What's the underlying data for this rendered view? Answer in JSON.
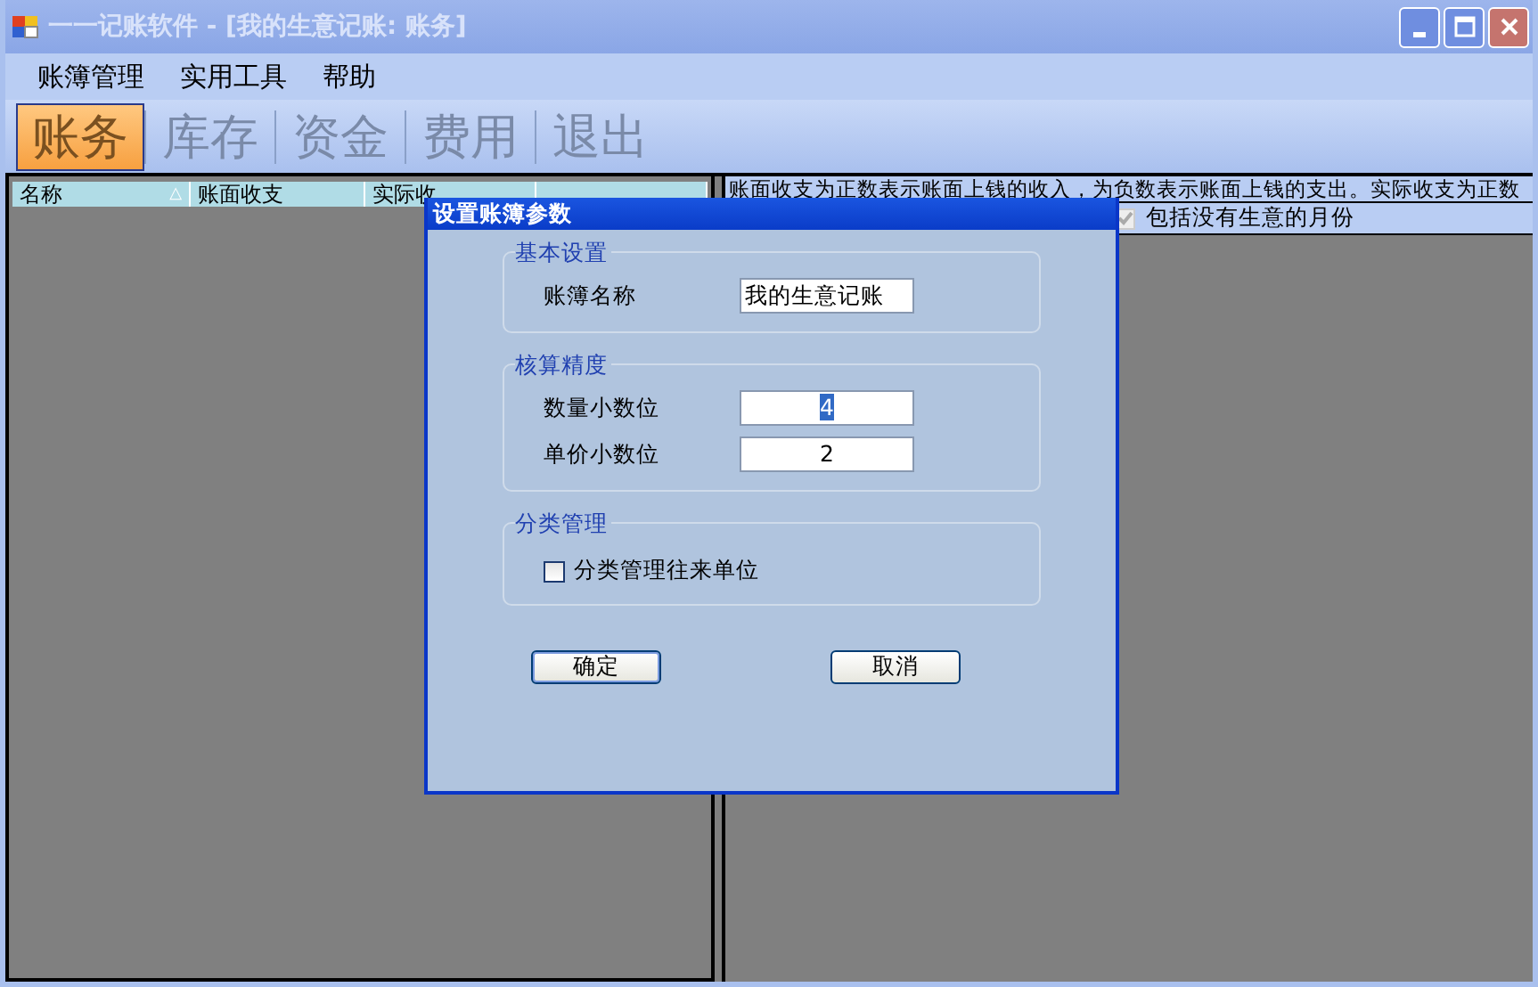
{
  "window": {
    "title": "一一记账软件 - [我的生意记账: 账务]"
  },
  "menu": [
    "账簿管理",
    "实用工具",
    "帮助"
  ],
  "toolbar": [
    {
      "label": "账务",
      "selected": true
    },
    {
      "label": "库存",
      "selected": false
    },
    {
      "label": "资金",
      "selected": false
    },
    {
      "label": "费用",
      "selected": false
    },
    {
      "label": "退出",
      "selected": false
    }
  ],
  "table": {
    "columns": [
      {
        "label": "名称",
        "sort_icon": "△"
      },
      {
        "label": "账面收支"
      },
      {
        "label": "实际收"
      }
    ]
  },
  "info": {
    "note": "账面收支为正数表示账面上钱的收入，为负数表示账面上钱的支出。实际收支为正数",
    "include_empty_months": {
      "label": "包括没有生意的月份",
      "checked": true
    }
  },
  "dialog": {
    "title": "设置账簿参数",
    "groups": [
      {
        "title": "基本设置",
        "fields": [
          {
            "label": "账簿名称",
            "value": "我的生意记账",
            "kind": "text",
            "text_selected": false
          }
        ]
      },
      {
        "title": "核算精度",
        "fields": [
          {
            "label": "数量小数位",
            "value": "4",
            "kind": "number",
            "text_selected": true
          },
          {
            "label": "单价小数位",
            "value": "2",
            "kind": "number",
            "text_selected": false
          }
        ]
      },
      {
        "title": "分类管理",
        "checkbox": {
          "label": "分类管理往来单位",
          "checked": false
        }
      }
    ],
    "buttons": [
      "确定",
      "取消"
    ]
  }
}
